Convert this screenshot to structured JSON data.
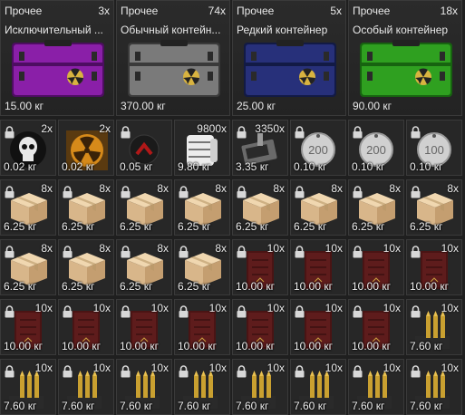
{
  "containers": [
    {
      "category": "Прочее",
      "quantity": "3x",
      "name": "Исключительный ...",
      "weight": "15.00 кг",
      "color": "#8a1fa8",
      "dark": "#4d0d61"
    },
    {
      "category": "Прочее",
      "quantity": "74x",
      "name": "Обычный контейн...",
      "weight": "370.00 кг",
      "color": "#7a7a7a",
      "dark": "#3a3a3a"
    },
    {
      "category": "Прочее",
      "quantity": "5x",
      "name": "Редкий контейнер",
      "weight": "25.00 кг",
      "color": "#27307a",
      "dark": "#121a45"
    },
    {
      "category": "Прочее",
      "quantity": "18x",
      "name": "Особый контейнер",
      "weight": "90.00 кг",
      "color": "#2fa020",
      "dark": "#176310"
    }
  ],
  "row1": [
    {
      "type": "skull",
      "quantity": "2x",
      "weight": "0.02 кг",
      "locked": true
    },
    {
      "type": "radiation",
      "quantity": "2x",
      "weight": "0.02 кг",
      "locked": false
    },
    {
      "type": "chevron",
      "quantity": "",
      "weight": "0.05 кг",
      "locked": true
    },
    {
      "type": "bandage",
      "quantity": "9800x",
      "weight": "9.80 кг",
      "locked": false
    },
    {
      "type": "device",
      "quantity": "3350x",
      "weight": "3.35 кг",
      "locked": true
    },
    {
      "type": "tag",
      "tag": "200",
      "quantity": "",
      "weight": "0.10 кг",
      "locked": true
    },
    {
      "type": "tag",
      "tag": "200",
      "quantity": "",
      "weight": "0.10 кг",
      "locked": true
    },
    {
      "type": "tag",
      "tag": "100",
      "quantity": "",
      "weight": "0.10 кг",
      "locked": true
    }
  ],
  "grid": [
    [
      {
        "type": "box",
        "quantity": "8x",
        "weight": "6.25 кг"
      },
      {
        "type": "box",
        "quantity": "8x",
        "weight": "6.25 кг"
      },
      {
        "type": "box",
        "quantity": "8x",
        "weight": "6.25 кг"
      },
      {
        "type": "box",
        "quantity": "8x",
        "weight": "6.25 кг"
      },
      {
        "type": "box",
        "quantity": "8x",
        "weight": "6.25 кг"
      },
      {
        "type": "box",
        "quantity": "8x",
        "weight": "6.25 кг"
      },
      {
        "type": "box",
        "quantity": "8x",
        "weight": "6.25 кг"
      },
      {
        "type": "box",
        "quantity": "8x",
        "weight": "6.25 кг"
      }
    ],
    [
      {
        "type": "box",
        "quantity": "8x",
        "weight": "6.25 кг"
      },
      {
        "type": "box",
        "quantity": "8x",
        "weight": "6.25 кг"
      },
      {
        "type": "box",
        "quantity": "8x",
        "weight": "6.25 кг"
      },
      {
        "type": "box",
        "quantity": "8x",
        "weight": "6.25 кг"
      },
      {
        "type": "book",
        "quantity": "10x",
        "weight": "10.00 кг"
      },
      {
        "type": "book",
        "quantity": "10x",
        "weight": "10.00 кг"
      },
      {
        "type": "book",
        "quantity": "10x",
        "weight": "10.00 кг"
      },
      {
        "type": "book",
        "quantity": "10x",
        "weight": "10.00 кг"
      }
    ],
    [
      {
        "type": "book",
        "quantity": "10x",
        "weight": "10.00 кг"
      },
      {
        "type": "book",
        "quantity": "10x",
        "weight": "10.00 кг"
      },
      {
        "type": "book",
        "quantity": "10x",
        "weight": "10.00 кг"
      },
      {
        "type": "book",
        "quantity": "10x",
        "weight": "10.00 кг"
      },
      {
        "type": "book",
        "quantity": "10x",
        "weight": "10.00 кг"
      },
      {
        "type": "book",
        "quantity": "10x",
        "weight": "10.00 кг"
      },
      {
        "type": "book",
        "quantity": "10x",
        "weight": "10.00 кг"
      },
      {
        "type": "ammo",
        "quantity": "10x",
        "weight": "7.60 кг"
      }
    ],
    [
      {
        "type": "ammo",
        "quantity": "10x",
        "weight": "7.60 кг"
      },
      {
        "type": "ammo",
        "quantity": "10x",
        "weight": "7.60 кг"
      },
      {
        "type": "ammo",
        "quantity": "10x",
        "weight": "7.60 кг"
      },
      {
        "type": "ammo",
        "quantity": "10x",
        "weight": "7.60 кг"
      },
      {
        "type": "ammo",
        "quantity": "10x",
        "weight": "7.60 кг"
      },
      {
        "type": "ammo",
        "quantity": "10x",
        "weight": "7.60 кг"
      },
      {
        "type": "ammo",
        "quantity": "10x",
        "weight": "7.60 кг"
      },
      {
        "type": "ammo",
        "quantity": "10x",
        "weight": "7.60 кг"
      }
    ]
  ]
}
